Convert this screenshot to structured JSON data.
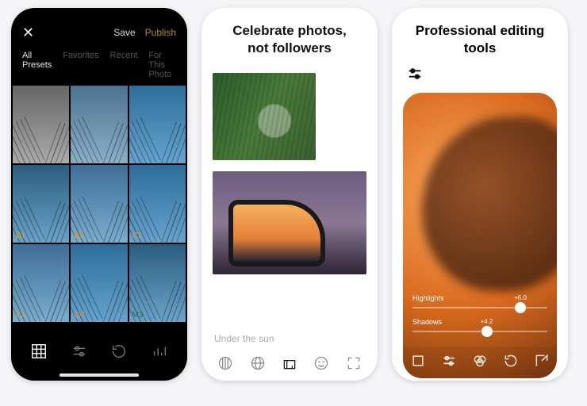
{
  "panel1": {
    "actions": {
      "save": "Save",
      "publish": "Publish"
    },
    "tabs": [
      "All Presets",
      "Favorites",
      "Recent",
      "For This Photo"
    ],
    "presets": [
      {
        "label": "",
        "style": "gray"
      },
      {
        "label": "",
        "style": "blue1"
      },
      {
        "label": "",
        "style": "blue3"
      },
      {
        "label": "B1",
        "style": "blue4"
      },
      {
        "label": "B5",
        "style": "blue2"
      },
      {
        "label": "C1",
        "style": "blue3"
      },
      {
        "label": "F2",
        "style": "blue2"
      },
      {
        "label": "G3",
        "style": "blue3"
      },
      {
        "label": "M3",
        "style": "blue4",
        "cold": true
      }
    ]
  },
  "panel2": {
    "title_line1": "Celebrate photos,",
    "title_line2": "not followers",
    "caption": "Under the sun"
  },
  "panel3": {
    "title_line1": "Professional editing",
    "title_line2": "tools",
    "sliders": {
      "highlights": {
        "label": "Highlights",
        "value": "+6.0",
        "pos": 80
      },
      "shadows": {
        "label": "Shadows",
        "value": "+4.2",
        "pos": 55
      }
    }
  }
}
